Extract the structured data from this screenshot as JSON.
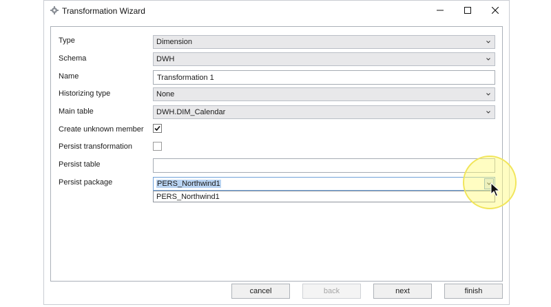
{
  "window": {
    "title": "Transformation Wizard",
    "controls": {
      "minimize": "minimize-icon",
      "maximize": "maximize-icon",
      "close": "close-icon"
    }
  },
  "form": {
    "type": {
      "label": "Type",
      "value": "Dimension"
    },
    "schema": {
      "label": "Schema",
      "value": "DWH"
    },
    "name": {
      "label": "Name",
      "value": "Transformation 1"
    },
    "historizing_type": {
      "label": "Historizing type",
      "value": "None"
    },
    "main_table": {
      "label": "Main table",
      "value": "DWH.DIM_Calendar"
    },
    "create_unknown_member": {
      "label": "Create unknown member",
      "checked": true
    },
    "persist_transformation": {
      "label": "Persist transformation",
      "checked": false
    },
    "persist_table": {
      "label": "Persist table",
      "value": ""
    },
    "persist_package": {
      "label": "Persist package",
      "value": "PERS_Northwind1",
      "options": [
        "PERS_Northwind1"
      ]
    }
  },
  "buttons": {
    "cancel": "cancel",
    "back": "back",
    "next": "next",
    "finish": "finish"
  },
  "colors": {
    "selection": "#b9d4f2",
    "focus_border": "#6fa1d8",
    "highlight": "#fffa78"
  }
}
